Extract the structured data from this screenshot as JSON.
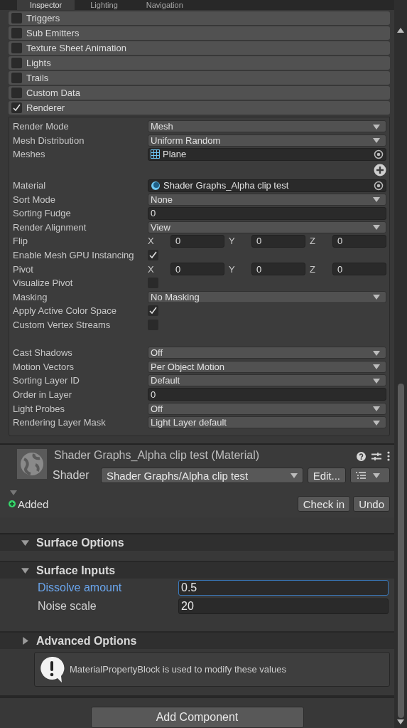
{
  "tabs": [
    {
      "label": "Inspector",
      "selected": true
    },
    {
      "label": "Lighting",
      "selected": false
    },
    {
      "label": "Navigation",
      "selected": false
    }
  ],
  "modules": [
    {
      "label": "Triggers",
      "checked": false
    },
    {
      "label": "Sub Emitters",
      "checked": false
    },
    {
      "label": "Texture Sheet Animation",
      "checked": false
    },
    {
      "label": "Lights",
      "checked": false
    },
    {
      "label": "Trails",
      "checked": false
    },
    {
      "label": "Custom Data",
      "checked": false
    },
    {
      "label": "Renderer",
      "checked": true
    }
  ],
  "renderer": [
    {
      "kind": "dropdown",
      "label": "Render Mode",
      "value": "Mesh"
    },
    {
      "kind": "dropdown",
      "label": "Mesh Distribution",
      "value": "Uniform Random"
    },
    {
      "kind": "mesh",
      "label": "Meshes",
      "value": "Plane"
    },
    {
      "kind": "add"
    },
    {
      "kind": "material",
      "label": "Material",
      "value": "Shader Graphs_Alpha clip test"
    },
    {
      "kind": "dropdown",
      "label": "Sort Mode",
      "value": "None"
    },
    {
      "kind": "number",
      "label": "Sorting Fudge",
      "value": "0"
    },
    {
      "kind": "dropdown",
      "label": "Render Alignment",
      "value": "View"
    },
    {
      "kind": "vector",
      "label": "Flip",
      "axes": [
        {
          "axis": "X",
          "value": "0"
        },
        {
          "axis": "Y",
          "value": "0"
        },
        {
          "axis": "Z",
          "value": "0"
        }
      ]
    },
    {
      "kind": "checkbox",
      "label": "Enable Mesh GPU Instancing",
      "checked": true
    },
    {
      "kind": "vector",
      "label": "Pivot",
      "axes": [
        {
          "axis": "X",
          "value": "0"
        },
        {
          "axis": "Y",
          "value": "0"
        },
        {
          "axis": "Z",
          "value": "0"
        }
      ]
    },
    {
      "kind": "checkbox",
      "label": "Visualize Pivot",
      "checked": false
    },
    {
      "kind": "dropdown",
      "label": "Masking",
      "value": "No Masking"
    },
    {
      "kind": "checkbox",
      "label": "Apply Active Color Space",
      "checked": true
    },
    {
      "kind": "checkbox",
      "label": "Custom Vertex Streams",
      "checked": false
    },
    {
      "kind": "spacer"
    },
    {
      "kind": "dropdown",
      "label": "Cast Shadows",
      "value": "Off"
    },
    {
      "kind": "dropdown",
      "label": "Motion Vectors",
      "value": "Per Object Motion"
    },
    {
      "kind": "dropdown",
      "label": "Sorting Layer ID",
      "value": "Default"
    },
    {
      "kind": "number",
      "label": "Order in Layer",
      "value": "0"
    },
    {
      "kind": "dropdown",
      "label": "Light Probes",
      "value": "Off"
    },
    {
      "kind": "dropdown",
      "label": "Rendering Layer Mask",
      "value": "Light Layer default"
    }
  ],
  "material": {
    "title": "Shader Graphs_Alpha clip test (Material)",
    "shader_label": "Shader",
    "shader": "Shader Graphs/Alpha clip test",
    "edit_button": "Edit...",
    "expanded": true,
    "status": "Added",
    "buttons": [
      "Check in",
      "Undo"
    ]
  },
  "sections": [
    {
      "title": "Surface Options",
      "expanded": true
    },
    {
      "title": "Surface Inputs",
      "expanded": true,
      "properties": [
        {
          "label": "Dissolve amount",
          "value": "0.5",
          "focused": true
        },
        {
          "label": "Noise scale",
          "value": "20",
          "focused": false
        }
      ]
    },
    {
      "title": "Advanced Options",
      "expanded": false
    }
  ],
  "help_box": {
    "message": "MaterialPropertyBlock is used to modify these values"
  },
  "add_component": "Add Component"
}
